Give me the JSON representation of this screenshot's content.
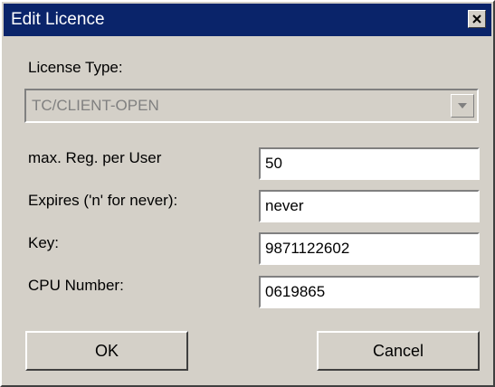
{
  "window": {
    "title": "Edit Licence",
    "close_icon": "close-icon"
  },
  "license_type": {
    "label": "License Type:",
    "value": "TC/CLIENT-OPEN",
    "disabled": true
  },
  "fields": [
    {
      "label": "max. Reg. per User",
      "value": "50"
    },
    {
      "label": "Expires ('n' for never):",
      "value": "never"
    },
    {
      "label": "Key:",
      "value": "9871122602"
    },
    {
      "label": "CPU Number:",
      "value": "0619865"
    }
  ],
  "buttons": {
    "ok": "OK",
    "cancel": "Cancel"
  },
  "colors": {
    "titlebar": "#0a246a",
    "face": "#d4d0c8",
    "disabled_text": "#808080"
  }
}
